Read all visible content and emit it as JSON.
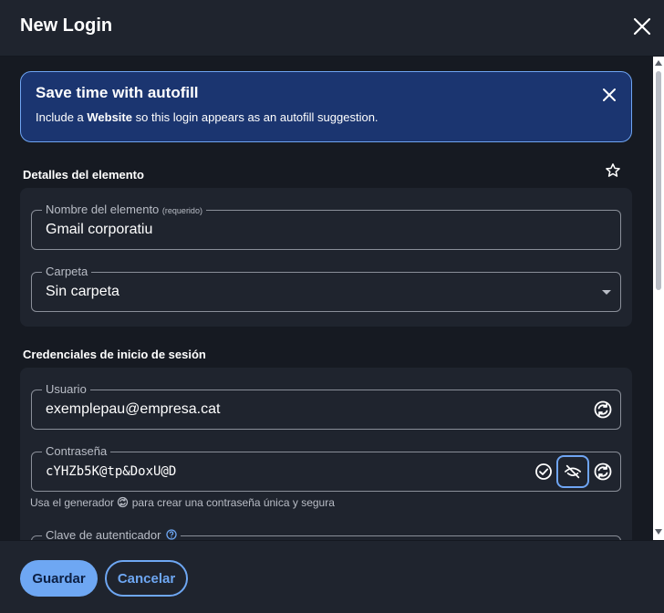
{
  "header": {
    "title": "New Login"
  },
  "banner": {
    "title": "Save time with autofill",
    "text_before": "Include a ",
    "text_bold": "Website",
    "text_after": " so this login appears as an autofill suggestion."
  },
  "item_details": {
    "section_title": "Detalles del elemento",
    "name_label": "Nombre del elemento",
    "name_required": "(requerido)",
    "name_value": "Gmail corporatiu",
    "folder_label": "Carpeta",
    "folder_value": "Sin carpeta"
  },
  "credentials": {
    "section_title": "Credenciales de inicio de sesión",
    "username_label": "Usuario",
    "username_value": "exemplepau@empresa.cat",
    "password_label": "Contraseña",
    "password_value": "cYHZb5K@tp&DoxU@D",
    "hint_before": "Usa el generador",
    "hint_after": "para crear una contraseña única y segura",
    "totp_label": "Clave de autenticador"
  },
  "footer": {
    "save_label": "Guardar",
    "cancel_label": "Cancelar"
  },
  "colors": {
    "accent": "#6ea7f3",
    "banner_bg": "#1b3570",
    "background": "#161a22",
    "card": "#1f242e"
  },
  "icons": [
    "close-icon",
    "star-icon",
    "generate-icon",
    "check-circle-icon",
    "eye-off-icon",
    "help-icon"
  ]
}
